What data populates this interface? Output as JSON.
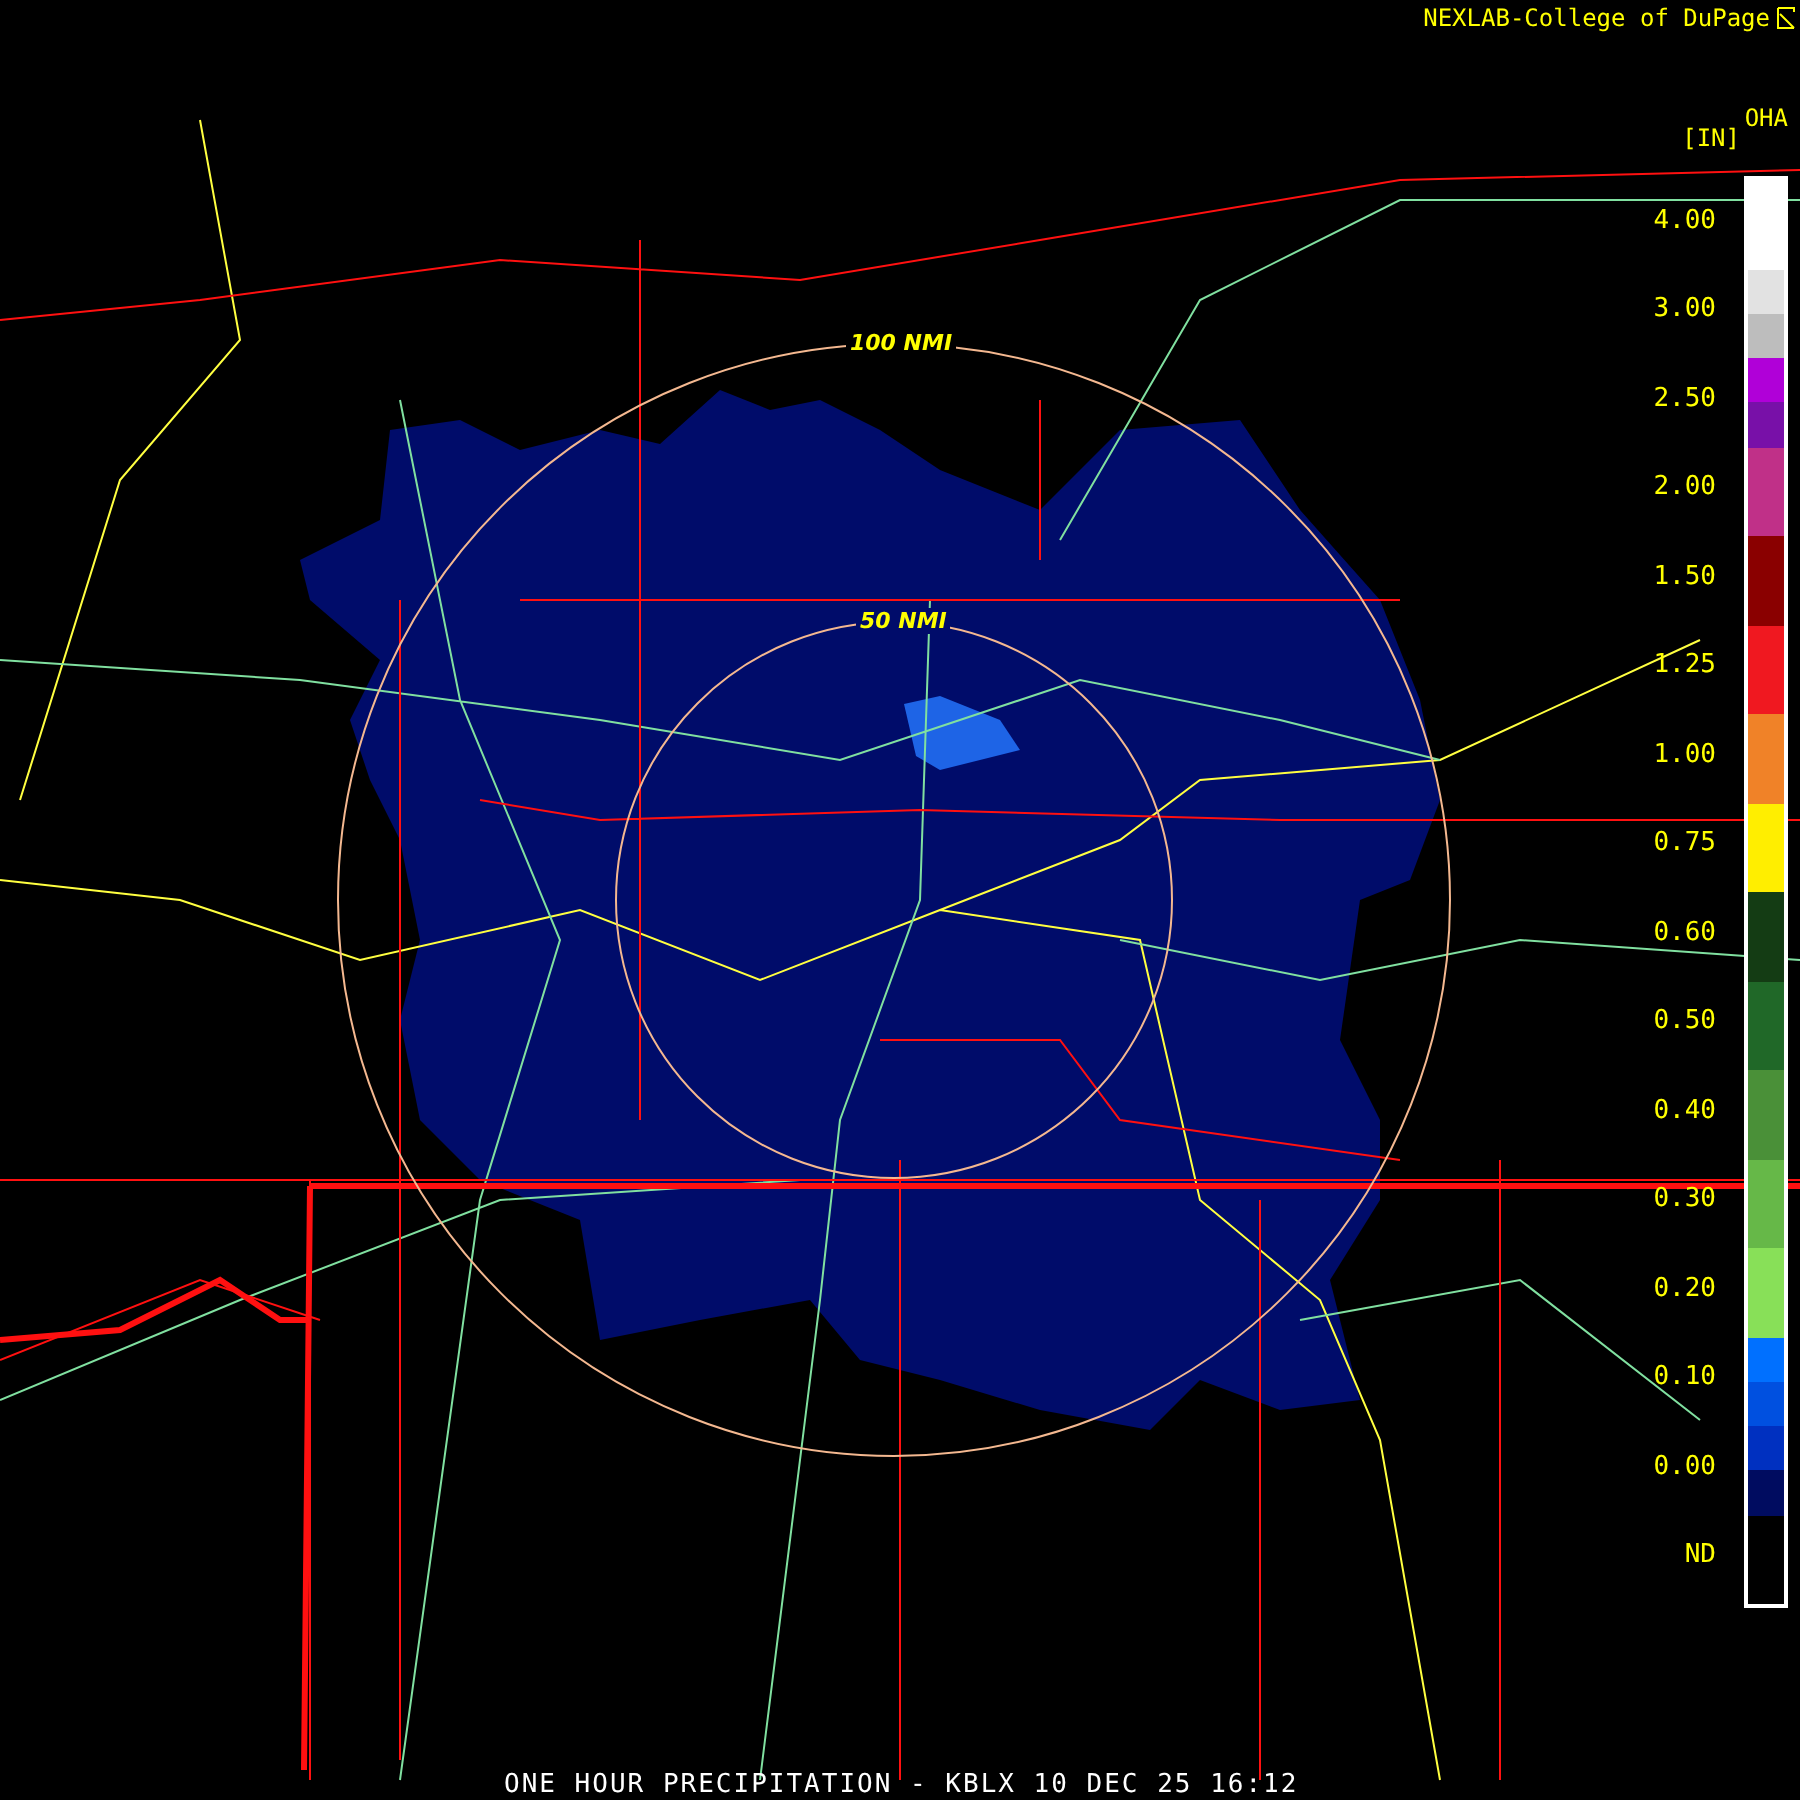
{
  "credit": "NEXLAB-College of DuPage",
  "units": "[IN]",
  "product": "OHA",
  "legend": [
    {
      "label": "4.00",
      "bins": [
        {
          "color": "#ffffff"
        }
      ]
    },
    {
      "label": "3.00",
      "bins": [
        {
          "color": "#e2e2e2"
        },
        {
          "color": "#bdbdbd"
        }
      ]
    },
    {
      "label": "2.50",
      "bins": [
        {
          "color": "#b000d8"
        },
        {
          "color": "#7810a8"
        }
      ]
    },
    {
      "label": "2.00",
      "bins": [
        {
          "color": "#c03088"
        }
      ]
    },
    {
      "label": "1.50",
      "bins": [
        {
          "color": "#8a0000"
        }
      ]
    },
    {
      "label": "1.25",
      "bins": [
        {
          "color": "#f01820"
        }
      ]
    },
    {
      "label": "1.00",
      "bins": [
        {
          "color": "#f08228"
        }
      ]
    },
    {
      "label": "0.75",
      "bins": [
        {
          "color": "#ffee00"
        }
      ]
    },
    {
      "label": "0.60",
      "bins": [
        {
          "color": "#143c14"
        }
      ]
    },
    {
      "label": "0.50",
      "bins": [
        {
          "color": "#206828"
        }
      ]
    },
    {
      "label": "0.40",
      "bins": [
        {
          "color": "#4a9038"
        }
      ]
    },
    {
      "label": "0.30",
      "bins": [
        {
          "color": "#66b848"
        }
      ]
    },
    {
      "label": "0.20",
      "bins": [
        {
          "color": "#88e058"
        }
      ]
    },
    {
      "label": "0.10",
      "bins": [
        {
          "color": "#0070ff"
        },
        {
          "color": "#0050e0"
        }
      ]
    },
    {
      "label": "0.00",
      "bins": [
        {
          "color": "#0030c0"
        },
        {
          "color": "#000c60"
        }
      ]
    },
    {
      "label": "ND",
      "bins": [
        {
          "color": "#000000"
        }
      ]
    }
  ],
  "range_rings": [
    {
      "label": "100 NMI"
    },
    {
      "label": "50 NMI"
    }
  ],
  "title": "ONE HOUR PRECIPITATION - KBLX 10 DEC 25 16:12"
}
